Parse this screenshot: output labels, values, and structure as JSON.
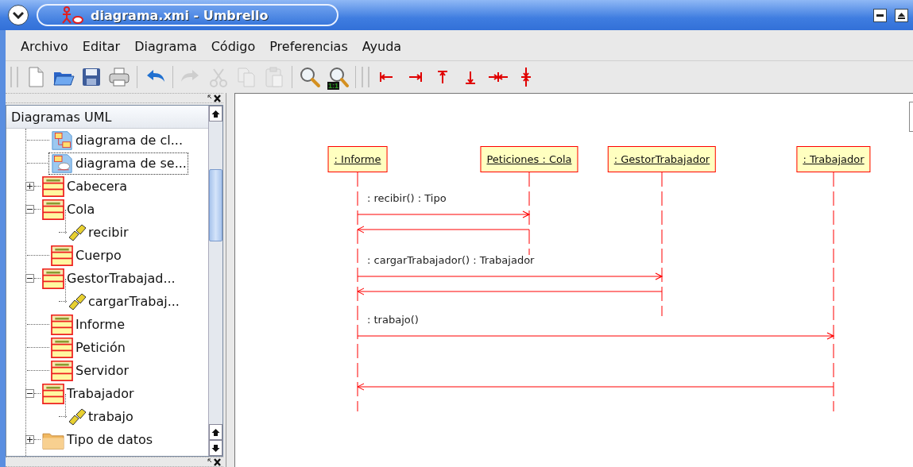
{
  "window": {
    "title": "diagrama.xmi - Umbrello"
  },
  "menu": [
    "Archivo",
    "Editar",
    "Diagrama",
    "Código",
    "Preferencias",
    "Ayuda"
  ],
  "toolbar": [
    {
      "kind": "new",
      "disabled": false
    },
    {
      "kind": "open",
      "disabled": false
    },
    {
      "kind": "save",
      "disabled": false
    },
    {
      "kind": "print",
      "disabled": false
    },
    {
      "kind": "undo",
      "disabled": false
    },
    {
      "kind": "redo",
      "disabled": true
    },
    {
      "kind": "cut",
      "disabled": true
    },
    {
      "kind": "copy",
      "disabled": true
    },
    {
      "kind": "paste",
      "disabled": true
    },
    {
      "kind": "zoom",
      "disabled": false
    },
    {
      "kind": "zoom-reset",
      "disabled": false,
      "badge": "1:1"
    },
    {
      "kind": "align-left",
      "disabled": false
    },
    {
      "kind": "align-right",
      "disabled": false
    },
    {
      "kind": "align-top",
      "disabled": false
    },
    {
      "kind": "align-bottom",
      "disabled": false
    },
    {
      "kind": "align-hcenter",
      "disabled": false
    },
    {
      "kind": "align-vcenter",
      "disabled": false
    }
  ],
  "tree": {
    "header": "Diagramas UML",
    "items": [
      {
        "label": "diagrama de cl...",
        "kind": "class-diagram",
        "selected": false
      },
      {
        "label": "diagrama de se...",
        "kind": "sequence-diagram",
        "selected": true
      },
      {
        "label": "Cabecera",
        "kind": "class",
        "selected": false,
        "expanded": false
      },
      {
        "label": "Cola",
        "kind": "class",
        "selected": false,
        "expanded": true,
        "children": [
          {
            "label": "recibir",
            "kind": "operation",
            "selected": false
          }
        ]
      },
      {
        "label": "Cuerpo",
        "kind": "class",
        "selected": false
      },
      {
        "label": "GestorTrabajad...",
        "kind": "class",
        "selected": false,
        "expanded": true,
        "children": [
          {
            "label": "cargarTrabaj...",
            "kind": "operation",
            "selected": false
          }
        ]
      },
      {
        "label": "Informe",
        "kind": "class",
        "selected": false
      },
      {
        "label": "Petición",
        "kind": "class",
        "selected": false
      },
      {
        "label": "Servidor",
        "kind": "class",
        "selected": false
      },
      {
        "label": "Trabajador",
        "kind": "class",
        "selected": false,
        "expanded": true,
        "children": [
          {
            "label": "trabajo",
            "kind": "operation",
            "selected": false
          }
        ]
      },
      {
        "label": "Tipo de datos",
        "kind": "folder",
        "selected": false,
        "expanded": false
      }
    ]
  },
  "diagram": {
    "lifelines": [
      {
        "name": ": Informe"
      },
      {
        "name": "Peticiones : Cola",
        "messages": [
          {
            "kind": "call",
            "label": ": recibir() : Tipo"
          },
          {
            "kind": "return"
          }
        ]
      },
      {
        "name": ": GestorTrabajador",
        "messages": [
          {
            "kind": "call",
            "label": ": cargarTrabajador() : Trabajador"
          },
          {
            "kind": "return"
          }
        ]
      },
      {
        "name": ": Trabajador",
        "messages": [
          {
            "kind": "call",
            "label": ": trabajo()"
          },
          {
            "kind": "return"
          }
        ]
      }
    ]
  }
}
